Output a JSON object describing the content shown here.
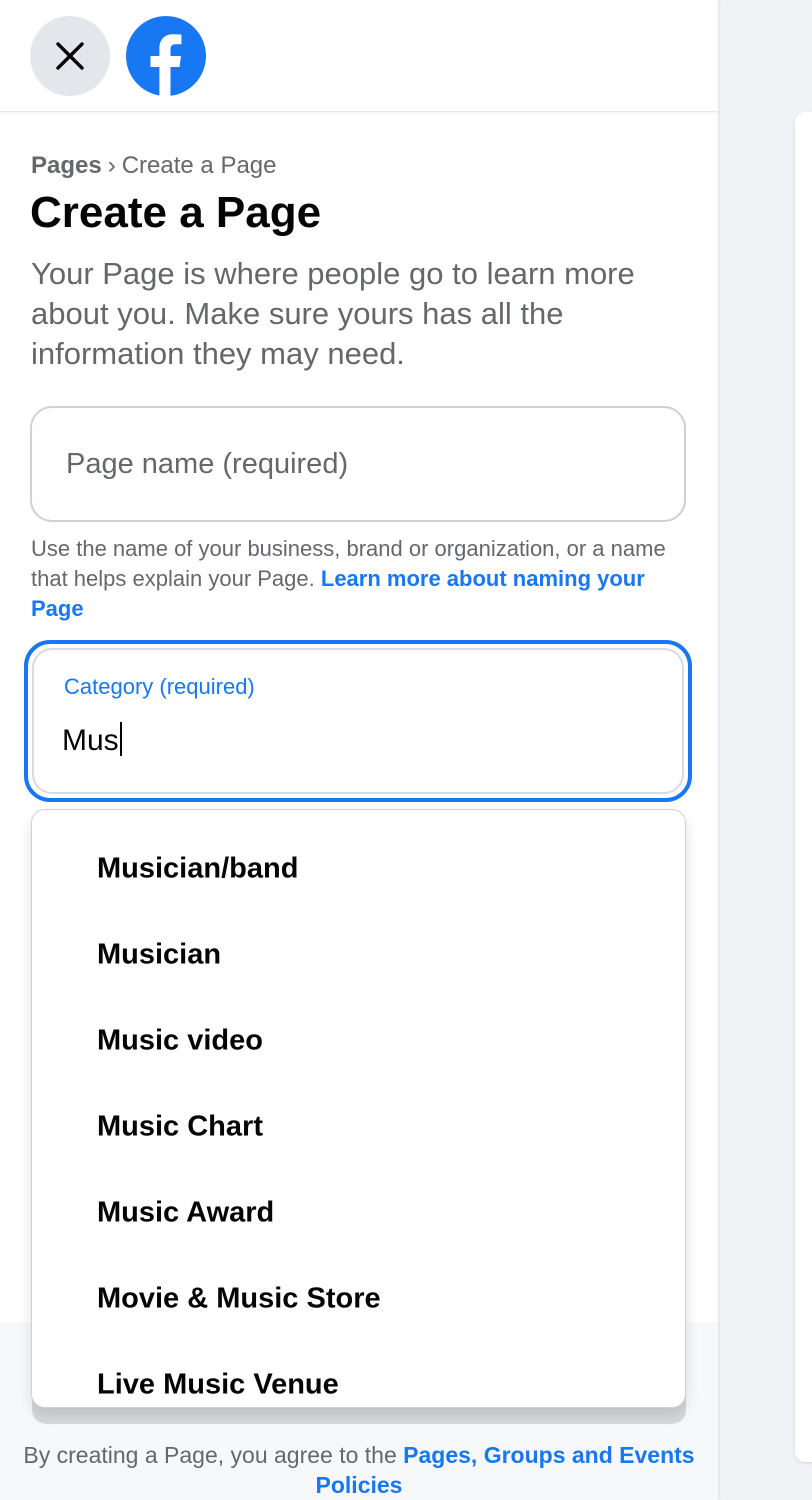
{
  "header": {
    "close_icon": "close-icon",
    "logo_icon": "facebook-logo-icon",
    "brand_color": "#1877f2"
  },
  "breadcrumb": {
    "root": "Pages",
    "separator": "›",
    "current": "Create a Page"
  },
  "title": "Create a Page",
  "intro": "Your Page is where people go to learn more about you. Make sure yours has all the information they may need.",
  "page_name": {
    "placeholder": "Page name (required)",
    "value": ""
  },
  "helper": {
    "text": "Use the name of your business, brand or organization, or a name that helps explain your Page.",
    "link": "Learn more about naming your Page"
  },
  "category": {
    "label": "Category (required)",
    "value": "Mus"
  },
  "suggestions": [
    "Musician/band",
    "Musician",
    "Music video",
    "Music Chart",
    "Music Award",
    "Movie & Music Store",
    "Live Music Venue"
  ],
  "terms": {
    "text": "By creating a Page, you agree to the",
    "link": "Pages, Groups and Events Policies"
  }
}
